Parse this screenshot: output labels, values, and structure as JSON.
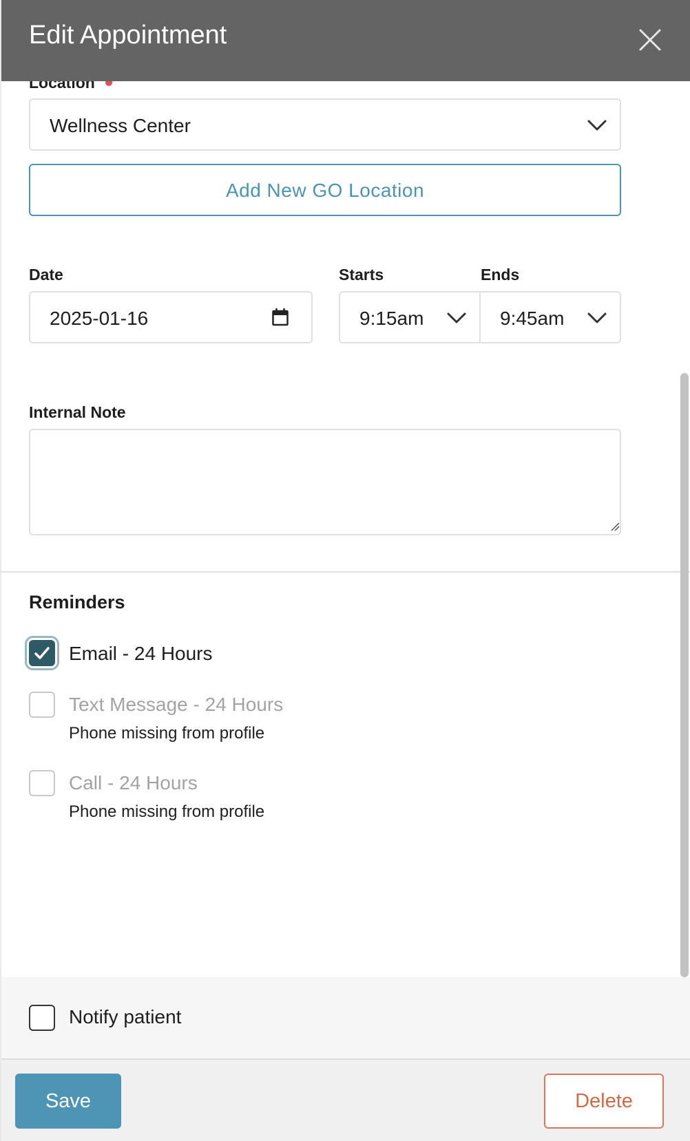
{
  "dialog": {
    "title": "Edit Appointment"
  },
  "location": {
    "label": "Location",
    "selected": "Wellness Center",
    "add_button": "Add New GO Location"
  },
  "date": {
    "label": "Date",
    "value": "2025-01-16"
  },
  "starts": {
    "label": "Starts",
    "value": "9:15am"
  },
  "ends": {
    "label": "Ends",
    "value": "9:45am"
  },
  "internal_note": {
    "label": "Internal Note",
    "value": ""
  },
  "reminders": {
    "title": "Reminders",
    "items": [
      {
        "label": "Email - 24 Hours",
        "checked": true,
        "disabled": false,
        "note": ""
      },
      {
        "label": "Text Message - 24 Hours",
        "checked": false,
        "disabled": true,
        "note": "Phone missing from profile"
      },
      {
        "label": "Call - 24 Hours",
        "checked": false,
        "disabled": true,
        "note": "Phone missing from profile"
      }
    ]
  },
  "notify": {
    "label": "Notify patient",
    "checked": false
  },
  "footer": {
    "save_label": "Save",
    "delete_label": "Delete"
  },
  "colors": {
    "header_bg": "#646464",
    "accent": "#4d94b5",
    "checkbox_checked": "#2e5a66",
    "danger": "#d06a47",
    "required": "#e05252"
  }
}
